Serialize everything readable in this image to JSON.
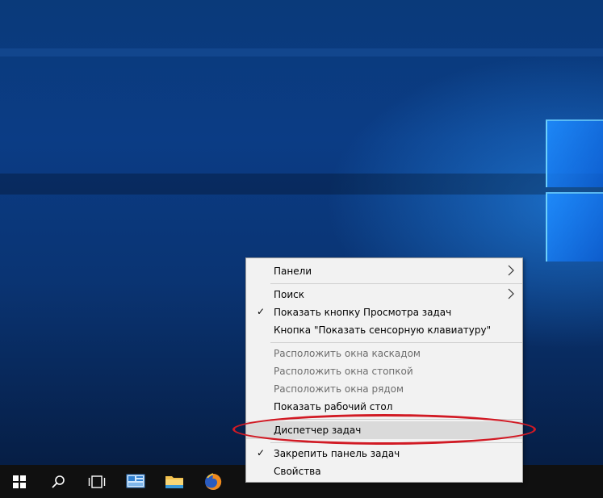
{
  "context_menu": {
    "items": [
      {
        "label": "Панели",
        "check": false,
        "submenu": true,
        "disabled": false,
        "highlight": false
      },
      {
        "label": "Поиск",
        "check": false,
        "submenu": true,
        "disabled": false,
        "highlight": false
      },
      {
        "label": "Показать кнопку Просмотра задач",
        "check": true,
        "submenu": false,
        "disabled": false,
        "highlight": false
      },
      {
        "label": "Кнопка \"Показать сенсорную клавиатуру\"",
        "check": false,
        "submenu": false,
        "disabled": false,
        "highlight": false
      },
      {
        "label": "Расположить окна каскадом",
        "check": false,
        "submenu": false,
        "disabled": true,
        "highlight": false
      },
      {
        "label": "Расположить окна стопкой",
        "check": false,
        "submenu": false,
        "disabled": true,
        "highlight": false
      },
      {
        "label": "Расположить окна рядом",
        "check": false,
        "submenu": false,
        "disabled": true,
        "highlight": false
      },
      {
        "label": "Показать рабочий стол",
        "check": false,
        "submenu": false,
        "disabled": false,
        "highlight": false
      },
      {
        "label": "Диспетчер задач",
        "check": false,
        "submenu": false,
        "disabled": false,
        "highlight": true
      },
      {
        "label": "Закрепить панель задач",
        "check": true,
        "submenu": false,
        "disabled": false,
        "highlight": false
      },
      {
        "label": "Свойства",
        "check": false,
        "submenu": false,
        "disabled": false,
        "highlight": false
      }
    ],
    "check_glyph": "✓",
    "arrow_glyph": "›"
  },
  "taskbar": {
    "icons": [
      "windows-start-icon",
      "search-icon",
      "task-view-icon",
      "control-panel-icon",
      "file-explorer-icon",
      "firefox-icon"
    ]
  },
  "colors": {
    "annotation": "#d11a24",
    "highlight": "#dadada",
    "menu_bg": "#f2f2f2"
  }
}
